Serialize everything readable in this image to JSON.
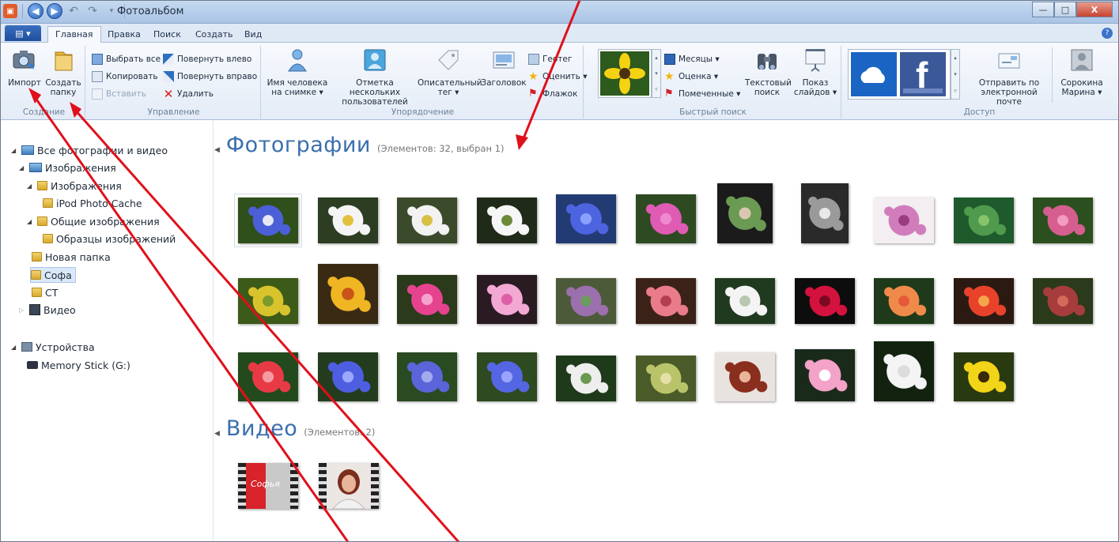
{
  "window": {
    "title": "Фотоальбом",
    "controls": {
      "minimize": "—",
      "maximize": "□",
      "close": "X"
    }
  },
  "ribbon": {
    "file_button": "▤ ▾",
    "tabs": [
      "Главная",
      "Правка",
      "Поиск",
      "Создать",
      "Вид"
    ],
    "active_tab": "Главная",
    "groups": {
      "create": {
        "label": "Создание",
        "import": "Импорт",
        "new_folder_1": "Создать",
        "new_folder_2": "папку"
      },
      "manage": {
        "label": "Управление",
        "select_all": "Выбрать все",
        "copy": "Копировать",
        "paste": "Вставить",
        "rotate_left": "Повернуть влево",
        "rotate_right": "Повернуть вправо",
        "delete": "Удалить"
      },
      "organize": {
        "label": "Упорядочение",
        "person_1": "Имя человека",
        "person_2": "на снимке ▾",
        "multi_1": "Отметка нескольких",
        "multi_2": "пользователей",
        "desc_1": "Описательный",
        "desc_2": "тег ▾",
        "caption": "Заголовок",
        "geotag": "Геотег",
        "rate": "Оценить ▾",
        "flag": "Флажок"
      },
      "quickfind": {
        "label": "Быстрый поиск",
        "months": "Месяцы ▾",
        "rating": "Оценка ▾",
        "flagged": "Помеченные ▾",
        "text_search_1": "Текстовый",
        "text_search_2": "поиск",
        "slideshow_1": "Показ",
        "slideshow_2": "слайдов ▾"
      },
      "share": {
        "label": "Доступ",
        "email_1": "Отправить по",
        "email_2": "электронной почте",
        "user_1": "Сорокина",
        "user_2": "Марина ▾"
      }
    }
  },
  "sidebar": {
    "all": "Все фотографии и видео",
    "images": "Изображения",
    "images_sub": "Изображения",
    "ipod": "iPod Photo Cache",
    "public_images": "Общие изображения",
    "samples": "Образцы изображений",
    "new_folder": "Новая папка",
    "sofa": "Софа",
    "ct": "CT",
    "video": "Видео",
    "devices": "Устройства",
    "memory_stick": "Memory Stick (G:)"
  },
  "main": {
    "photos_title": "Фотографии",
    "photos_count": "(Элементов: 32, выбран 1)",
    "video_title": "Видео",
    "video_count": "(Элементов: 2)",
    "video_label": "Софья"
  },
  "colors": {
    "accent": "#3a6fae",
    "annotation": "#e0101a"
  }
}
